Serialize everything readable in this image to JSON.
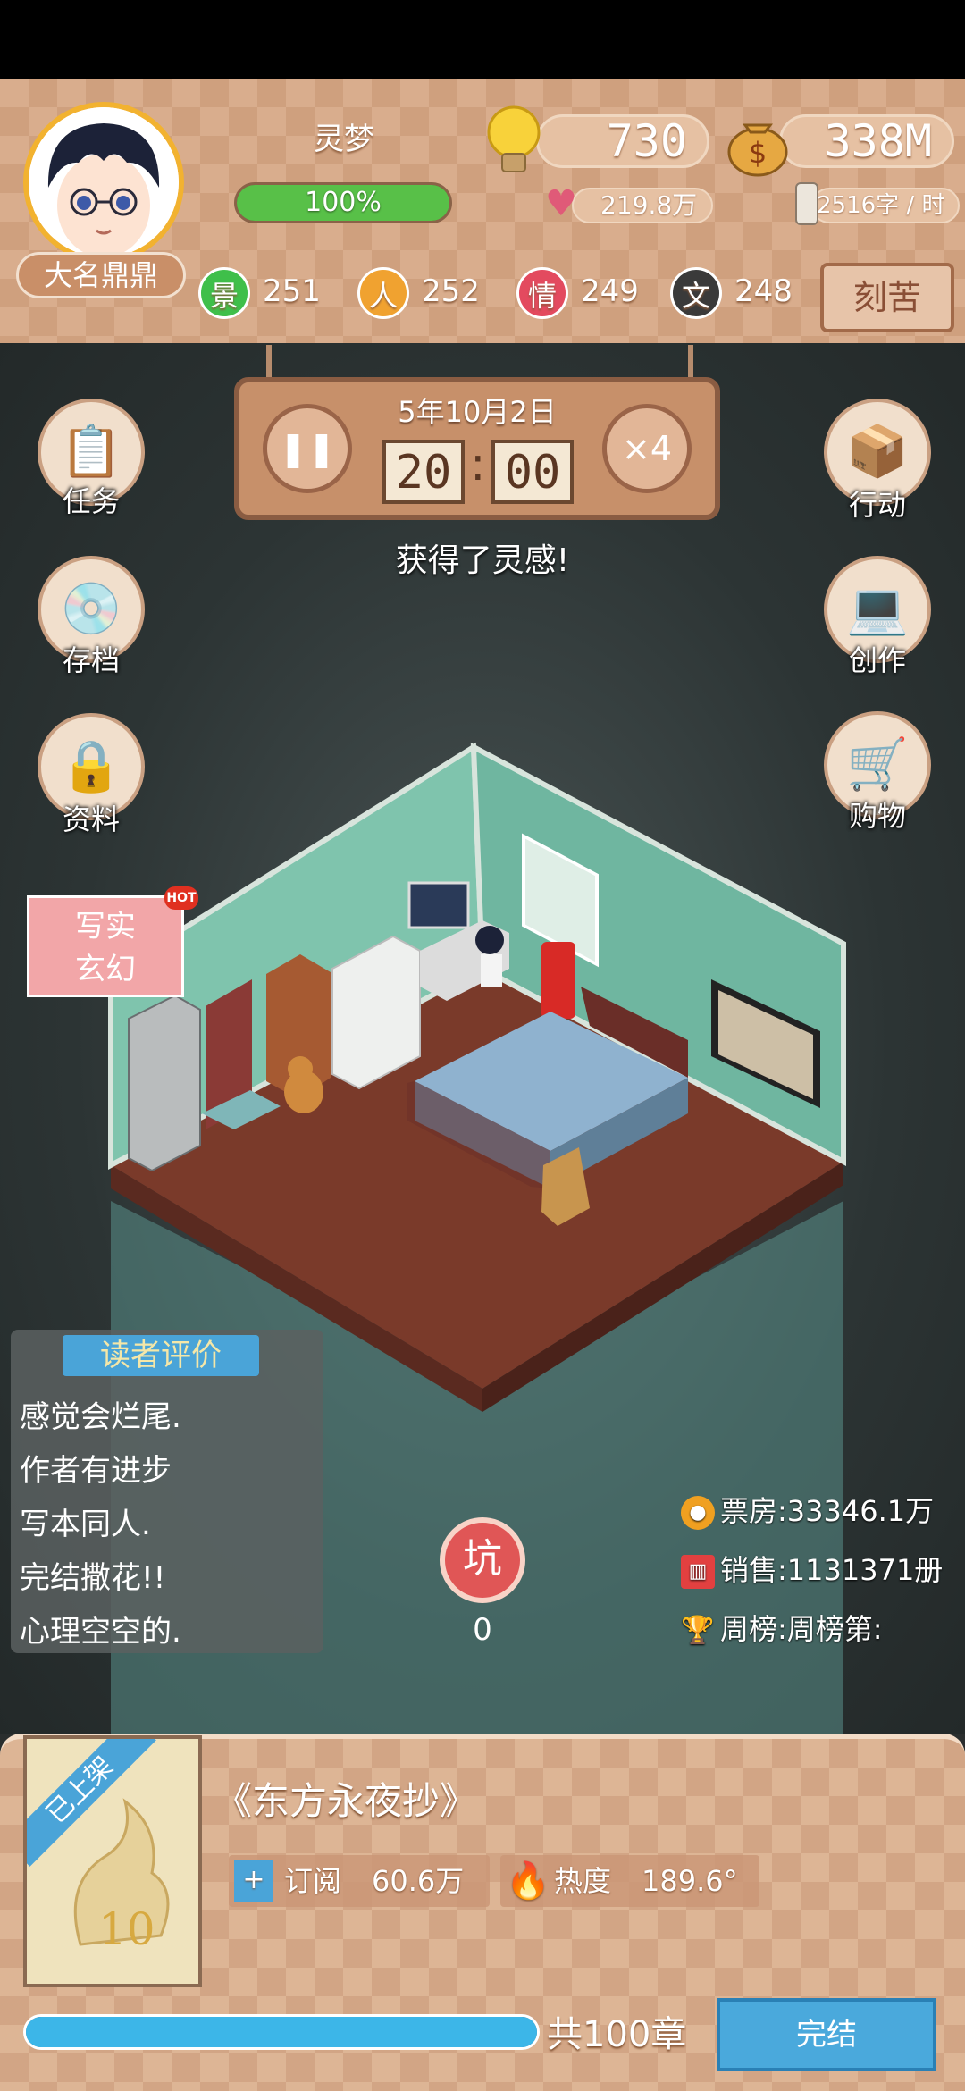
{
  "header": {
    "player_name": "灵梦",
    "nickname": "大名鼎鼎",
    "hp_percent": 100,
    "hp_text": "100%",
    "inspiration": "730",
    "money": "338M",
    "fans": "219.8万",
    "speed": "2516字 / 时",
    "stats": [
      {
        "label": "景",
        "value": "251",
        "color": "#3fbf4a"
      },
      {
        "label": "人",
        "value": "252",
        "color": "#f0a230"
      },
      {
        "label": "情",
        "value": "249",
        "color": "#e34a5f"
      },
      {
        "label": "文",
        "value": "248",
        "color": "#3a3a3a"
      }
    ],
    "kuh_label": "刻苦"
  },
  "clock": {
    "date": "5年10月2日",
    "hour": "20",
    "minute": "00",
    "speed_label": "×4"
  },
  "message": "获得了灵感!",
  "left_menu": [
    {
      "label": "任务",
      "icon": "task-icon",
      "glyph": "📋"
    },
    {
      "label": "存档",
      "icon": "save-icon",
      "glyph": "💿"
    },
    {
      "label": "资料",
      "icon": "lock-icon",
      "glyph": "🔒"
    }
  ],
  "right_menu": [
    {
      "label": "行动",
      "icon": "action-icon",
      "glyph": "📦"
    },
    {
      "label": "创作",
      "icon": "laptop-icon",
      "glyph": "💻"
    },
    {
      "label": "购物",
      "icon": "cart-icon",
      "glyph": "🛒"
    }
  ],
  "genre_tag": {
    "line1": "写实",
    "line2": "玄幻",
    "badge": "HOT"
  },
  "reviews": {
    "title": "读者评价",
    "lines": [
      "感觉会烂尾.",
      "作者有进步",
      "写本同人.",
      "完结撒花!!",
      "心理空空的."
    ]
  },
  "right_stats": {
    "box_office": "票房:33346.1万",
    "sales": "销售:1131371册",
    "ranking": "周榜:周榜第:"
  },
  "pit": {
    "label": "坑",
    "count": "0"
  },
  "book": {
    "shelf_badge": "已上架",
    "title": "《东方永夜抄》",
    "subscribe_label": "订阅",
    "subscribe_value": "60.6万",
    "heat_label": "热度",
    "heat_value": "189.6°",
    "progress_percent": 100,
    "chapters": "共100章",
    "finish_label": "完结"
  }
}
